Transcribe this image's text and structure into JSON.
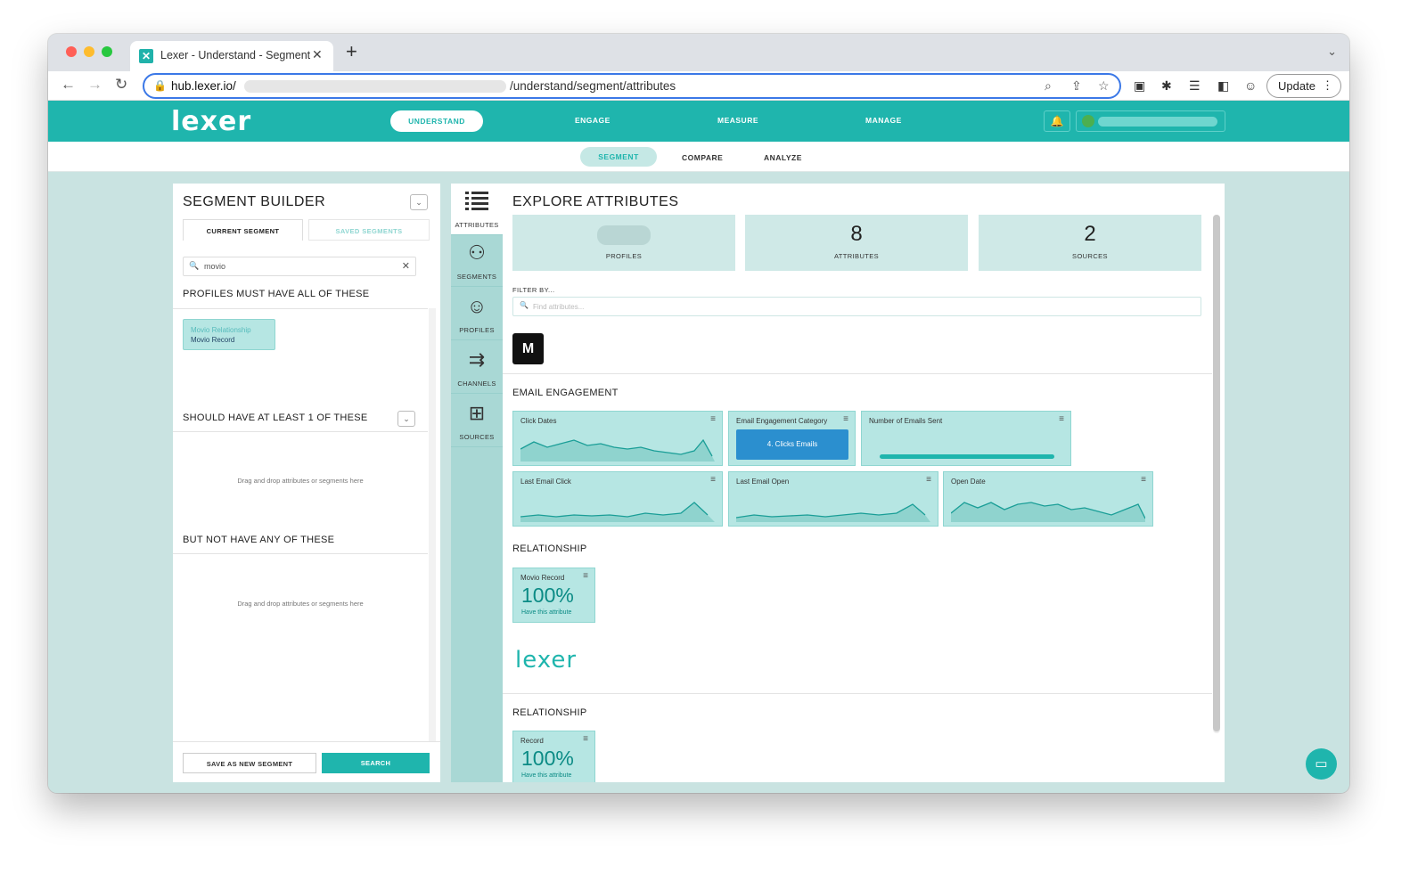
{
  "browser": {
    "tab_title": "Lexer - Understand - Segment",
    "tab_close": "✕",
    "new_tab": "+",
    "url_host": "hub.lexer.io/",
    "url_path": "/understand/segment/attributes",
    "update_label": "Update"
  },
  "app": {
    "logo": "lexer",
    "nav": [
      "UNDERSTAND",
      "ENGAGE",
      "MEASURE",
      "MANAGE"
    ],
    "subnav": [
      "SEGMENT",
      "COMPARE",
      "ANALYZE"
    ]
  },
  "segment_builder": {
    "title": "SEGMENT BUILDER",
    "tabs": [
      "CURRENT SEGMENT",
      "SAVED SEGMENTS"
    ],
    "search_value": "movio",
    "must_have": "PROFILES MUST HAVE ALL OF THESE",
    "chip": {
      "line1": "Movio Relationship",
      "line2": "Movio Record"
    },
    "should_have": "SHOULD HAVE AT LEAST 1 OF THESE",
    "not_have": "BUT NOT HAVE ANY OF THESE",
    "drop_hint": "Drag and drop attributes or segments here",
    "save_button": "SAVE AS NEW SEGMENT",
    "search_button": "SEARCH"
  },
  "rail": [
    {
      "label": "ATTRIBUTES",
      "icon": "list-icon"
    },
    {
      "label": "SEGMENTS",
      "icon": "segments-icon"
    },
    {
      "label": "PROFILES",
      "icon": "profile-icon"
    },
    {
      "label": "CHANNELS",
      "icon": "channels-icon"
    },
    {
      "label": "SOURCES",
      "icon": "sources-icon"
    }
  ],
  "explore": {
    "title": "EXPLORE ATTRIBUTES",
    "stats": [
      {
        "label": "PROFILES",
        "value": ""
      },
      {
        "label": "ATTRIBUTES",
        "value": "8"
      },
      {
        "label": "SOURCES",
        "value": "2"
      }
    ],
    "filter_label": "FILTER BY...",
    "filter_placeholder": "Find attributes...",
    "source1_logo": "M",
    "email_section": "EMAIL ENGAGEMENT",
    "cards": {
      "click_dates": "Click Dates",
      "engagement_category": "Email Engagement Category",
      "engagement_value": "4. Clicks Emails",
      "emails_sent": "Number of Emails Sent",
      "last_click": "Last Email Click",
      "last_open": "Last Email Open",
      "open_date": "Open Date"
    },
    "relationship_section": "RELATIONSHIP",
    "movio_record": {
      "title": "Movio Record",
      "value": "100%",
      "sub": "Have this attribute"
    },
    "source2_logo": "lexer",
    "relationship_section2": "RELATIONSHIP",
    "record": {
      "title": "Record",
      "value": "100%",
      "sub": "Have this attribute"
    }
  },
  "colors": {
    "accent": "#1fb5ad",
    "card": "#b6e6e3",
    "pill": "#2b8fcf"
  }
}
